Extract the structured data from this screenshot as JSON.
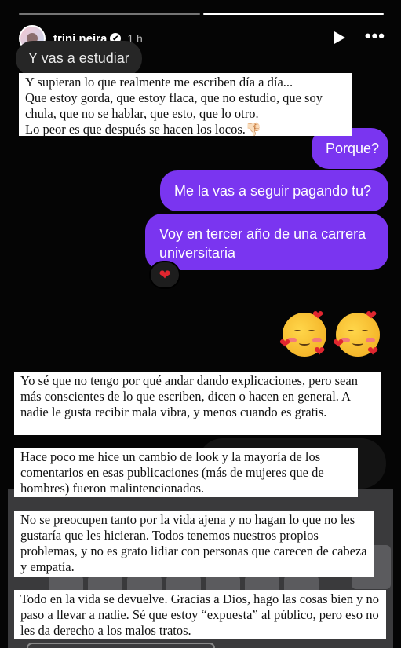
{
  "header": {
    "username": "trini.neira",
    "verified_mark": "✔",
    "time": "1 h",
    "more_label": "•••"
  },
  "chat": {
    "incoming": "Y vas a estudiar",
    "outgoing": [
      "Porque?",
      "Me la vas a seguir pagando tu?",
      "Voy en tercer año de una carrera universitaria"
    ],
    "reaction": "❤"
  },
  "text_boxes": [
    "Y supieran lo que realmente me escriben día a día...\nQue estoy gorda, que estoy flaca, que no estudio, que soy chula, que no se hablar, que esto, que lo otro.\nLo peor es que después se hacen los locos.👎🏻",
    "Yo sé que no tengo por qué andar dando explicaciones, pero sean más conscientes de lo que escriben, dicen o hacen en general. A nadie le gusta recibir mala vibra, y menos cuando es gratis.",
    "Hace poco me hice un cambio de look y la mayoría de los comentarios en esas publicaciones (más de mujeres que de hombres) fueron malintencionados.",
    "No se preocupen tanto por la vida ajena y no hagan lo que no les gustaría que les hicieran. Todos tenemos nuestros propios problemas, y no es grato lidiar con personas que carecen de cabeza y empatía.",
    "Todo en la vida se devuelve. Gracias a Dios, hago las cosas bien y no paso a llevar a nadie. Sé que estoy “expuesta” al público, pero eso no les da derecho a los malos tratos."
  ],
  "colors": {
    "bubble_outgoing": "#7a35f0",
    "bubble_incoming": "#262626",
    "reaction_heart": "#e0262f"
  }
}
